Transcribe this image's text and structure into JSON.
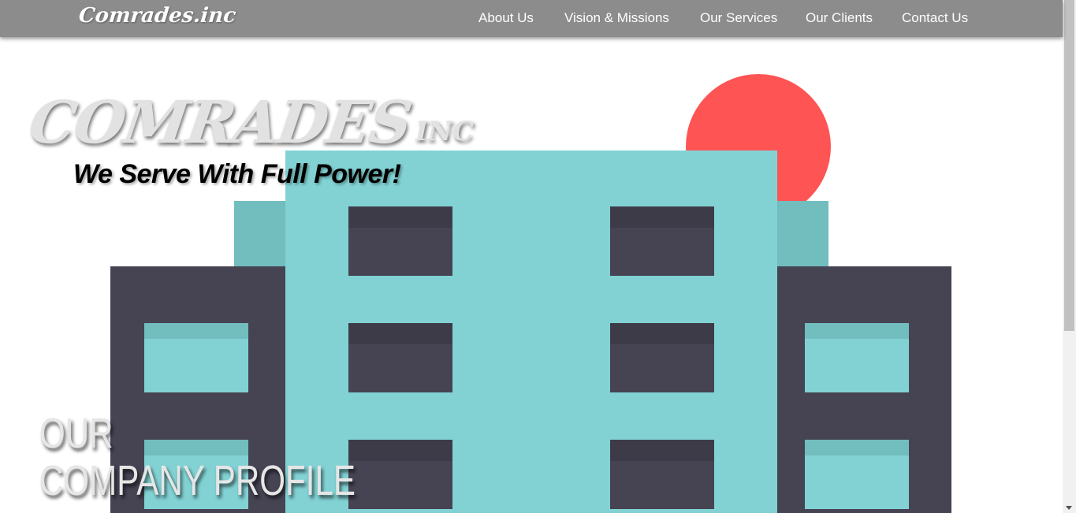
{
  "header": {
    "brand": "Comrades.inc",
    "nav": [
      "About Us",
      "Vision & Missions",
      "Our Services",
      "Our Clients",
      "Contact Us"
    ]
  },
  "hero": {
    "logo_main": "COMRADES",
    "logo_suffix": "INC",
    "tagline": "We Serve With Full Power!",
    "heading_line1": "OUR",
    "heading_line2": "COMPANY PROFILE"
  },
  "colors": {
    "navbar": "#8c8c8c",
    "sun": "#fe5454",
    "building_teal": "#82d2d4",
    "building_dark": "#464353"
  }
}
